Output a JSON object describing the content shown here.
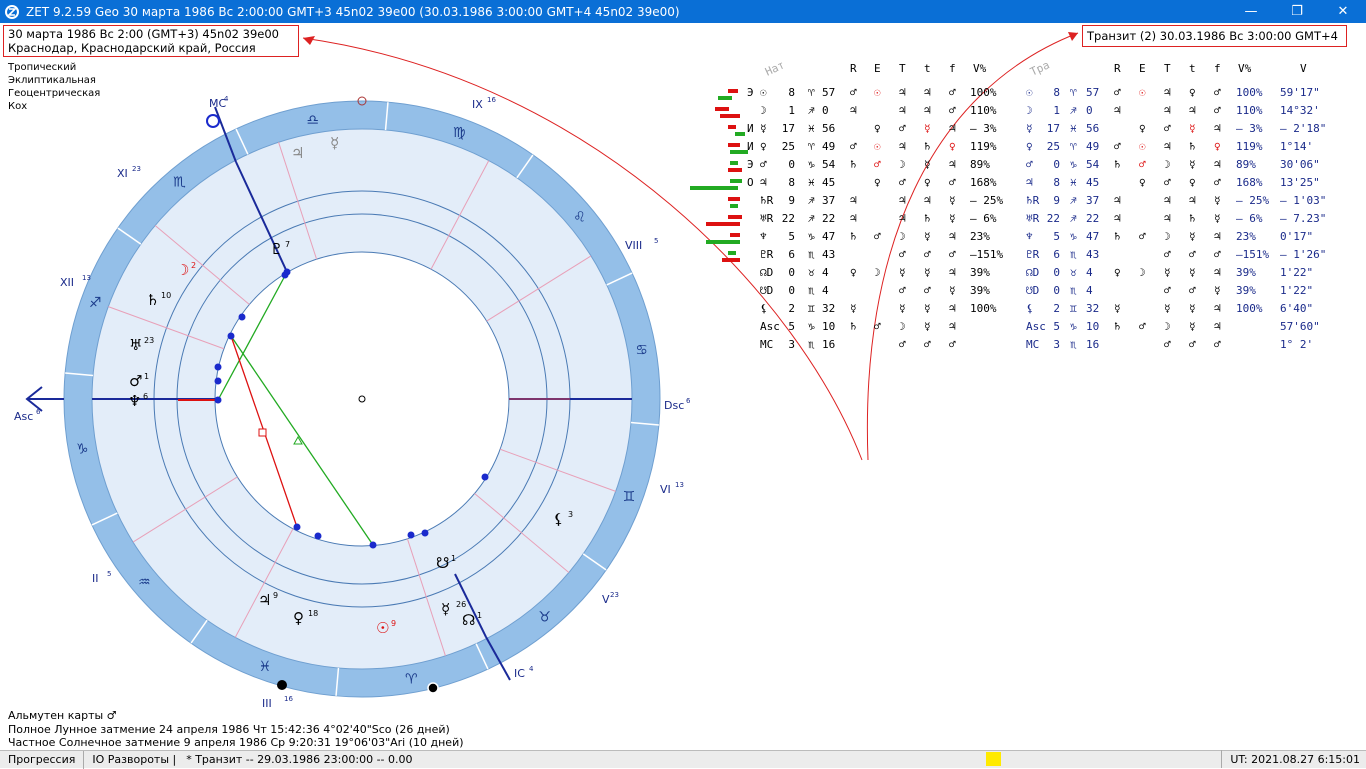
{
  "window": {
    "title": "ZET 9.2.59 Geo   30 марта 1986  Вс   2:00:00 GMT+3 45n02  39e00  (30.03.1986   3:00:00 GMT+4 45n02 39e00)",
    "minimize_icon": "minimize-icon",
    "maximize_icon": "restore-icon",
    "close_icon": "close-icon"
  },
  "info_box": {
    "line1": "30 марта 1986  Вс   2:00 (GMT+3) 45n02  39e00",
    "line2": "Краснодар, Краснодарский край, Россия"
  },
  "transit_box": {
    "text": "Транзит (2) 30.03.1986  Вс  3:00:00 GMT+4"
  },
  "zodiac_info": {
    "line1": "Тропический",
    "line2": "Эклиптикальная",
    "line3": "Геоцентрическая",
    "line4": "Кох"
  },
  "bottom_notes": {
    "line1": "Альмутен карты  ♂",
    "line2": "Полное Лунное затмение 24 апреля 1986 Чт 15:42:36  4°02'40\"Sco (26 дней)",
    "line3": "Частное Солнечное затмение 9 апреля 1986 Ср  9:20:31 19°06'03\"Ari (10 дней)"
  },
  "statusbar": {
    "progression": "Прогрессия",
    "turns": "IO Развороты |",
    "transit": "*  Транзит -- 29.03.1986 23:00:00 -- 0.00",
    "ut": "UT: 2021.08.27  6:15:01"
  },
  "colors": {
    "titlebar": "#0a6fd6",
    "wheel_outer": "#94bfe8",
    "wheel_inner": "#e3edf9",
    "accent_red": "#dd1111",
    "text_blue": "#1a2a8a",
    "aspect_green": "#22aa22"
  },
  "table": {
    "headers": {
      "nat": "Нат",
      "r": "R",
      "e": "E",
      "t": "T",
      "t2": "t",
      "f": "f",
      "v": "V%",
      "tra": "Тра",
      "r2": "R",
      "e2": "E",
      "t3": "T",
      "t4": "t",
      "f2": "f",
      "v2": "V%",
      "vel": "V"
    },
    "rows": [
      {
        "mark": "Э",
        "p": "☉",
        "deg": "8",
        "sign": "♈",
        "min": "57",
        "a": "♂",
        "b": "☉",
        "c": "♃",
        "d": "♃",
        "e": "♂",
        "pct": "100%",
        "tp": "☉",
        "tdeg": "8",
        "tsign": "♈",
        "tmin": "57",
        "ta": "♂",
        "tb": "☉",
        "tc": "♃",
        "td": "♀",
        "te": "♂",
        "tpct": "100%",
        "vel": "59'17\""
      },
      {
        "mark": "",
        "p": "☽",
        "deg": "1",
        "sign": "♐",
        "min": "0",
        "a": "♃",
        "b": "",
        "c": "♃",
        "d": "♃",
        "e": "♂",
        "pct": "110%",
        "tp": "☽",
        "tdeg": "1",
        "tsign": "♐",
        "tmin": "0",
        "ta": "♃",
        "tb": "",
        "tc": "♃",
        "td": "♃",
        "te": "♂",
        "tpct": "110%",
        "vel": "14°32'"
      },
      {
        "mark": "И",
        "p": "☿",
        "deg": "17",
        "sign": "♓",
        "min": "56",
        "a": "",
        "b": "♀",
        "c": "♂",
        "d": "☿",
        "e": "♃",
        "pct": "– 3%",
        "tp": "☿",
        "tdeg": "17",
        "tsign": "♓",
        "tmin": "56",
        "ta": "",
        "tb": "♀",
        "tc": "♂",
        "td": "☿",
        "te": "♃",
        "tpct": "– 3%",
        "vel": "– 2'18\""
      },
      {
        "mark": "И",
        "p": "♀",
        "deg": "25",
        "sign": "♈",
        "min": "49",
        "a": "♂",
        "b": "☉",
        "c": "♃",
        "d": "♄",
        "e": "♀",
        "pct": "119%",
        "tp": "♀",
        "tdeg": "25",
        "tsign": "♈",
        "tmin": "49",
        "ta": "♂",
        "tb": "☉",
        "tc": "♃",
        "td": "♄",
        "te": "♀",
        "tpct": "119%",
        "vel": "1°14'"
      },
      {
        "mark": "Э",
        "p": "♂",
        "deg": "0",
        "sign": "♑",
        "min": "54",
        "a": "♄",
        "b": "♂",
        "c": "☽",
        "d": "☿",
        "e": "♃",
        "pct": "89%",
        "tp": "♂",
        "tdeg": "0",
        "tsign": "♑",
        "tmin": "54",
        "ta": "♄",
        "tb": "♂",
        "tc": "☽",
        "td": "☿",
        "te": "♃",
        "tpct": "89%",
        "vel": "30'06\""
      },
      {
        "mark": "О",
        "p": "♃",
        "deg": "8",
        "sign": "♓",
        "min": "45",
        "a": "",
        "b": "♀",
        "c": "♂",
        "d": "♀",
        "e": "♂",
        "pct": "168%",
        "tp": "♃",
        "tdeg": "8",
        "tsign": "♓",
        "tmin": "45",
        "ta": "",
        "tb": "♀",
        "tc": "♂",
        "td": "♀",
        "te": "♂",
        "tpct": "168%",
        "vel": "13'25\""
      },
      {
        "mark": "",
        "p": "♄R",
        "deg": "9",
        "sign": "♐",
        "min": "37",
        "a": "♃",
        "b": "",
        "c": "♃",
        "d": "♃",
        "e": "☿",
        "pct": "– 25%",
        "tp": "♄R",
        "tdeg": "9",
        "tsign": "♐",
        "tmin": "37",
        "ta": "♃",
        "tb": "",
        "tc": "♃",
        "td": "♃",
        "te": "☿",
        "tpct": "– 25%",
        "vel": "– 1'03\""
      },
      {
        "mark": "",
        "p": "♅R",
        "deg": "22",
        "sign": "♐",
        "min": "22",
        "a": "♃",
        "b": "",
        "c": "♃",
        "d": "♄",
        "e": "☿",
        "pct": "– 6%",
        "tp": "♅R",
        "tdeg": "22",
        "tsign": "♐",
        "tmin": "22",
        "ta": "♃",
        "tb": "",
        "tc": "♃",
        "td": "♄",
        "te": "☿",
        "tpct": "– 6%",
        "vel": "– 7.23\""
      },
      {
        "mark": "",
        "p": "♆",
        "deg": "5",
        "sign": "♑",
        "min": "47",
        "a": "♄",
        "b": "♂",
        "c": "☽",
        "d": "☿",
        "e": "♃",
        "pct": "23%",
        "tp": "♆",
        "tdeg": "5",
        "tsign": "♑",
        "tmin": "47",
        "ta": "♄",
        "tb": "♂",
        "tc": "☽",
        "td": "☿",
        "te": "♃",
        "tpct": "23%",
        "vel": "0'17\""
      },
      {
        "mark": "",
        "p": "♇R",
        "deg": "6",
        "sign": "♏",
        "min": "43",
        "a": "",
        "b": "",
        "c": "♂",
        "d": "♂",
        "e": "♂",
        "pct": "–151%",
        "tp": "♇R",
        "tdeg": "6",
        "tsign": "♏",
        "tmin": "43",
        "ta": "",
        "tb": "",
        "tc": "♂",
        "td": "♂",
        "te": "♂",
        "tpct": "–151%",
        "vel": "– 1'26\""
      },
      {
        "mark": "",
        "p": "☊D",
        "deg": "0",
        "sign": "♉",
        "min": "4",
        "a": "♀",
        "b": "☽",
        "c": "☿",
        "d": "☿",
        "e": "♃",
        "pct": "39%",
        "tp": "☊D",
        "tdeg": "0",
        "tsign": "♉",
        "tmin": "4",
        "ta": "♀",
        "tb": "☽",
        "tc": "☿",
        "td": "☿",
        "te": "♃",
        "tpct": "39%",
        "vel": "1'22\""
      },
      {
        "mark": "",
        "p": "☋D",
        "deg": "0",
        "sign": "♏",
        "min": "4",
        "a": "",
        "b": "",
        "c": "♂",
        "d": "♂",
        "e": "☿",
        "pct": "39%",
        "tp": "☋D",
        "tdeg": "0",
        "tsign": "♏",
        "tmin": "4",
        "ta": "",
        "tb": "",
        "tc": "♂",
        "td": "♂",
        "te": "☿",
        "tpct": "39%",
        "vel": "1'22\""
      },
      {
        "mark": "",
        "p": "⚸",
        "deg": "2",
        "sign": "♊",
        "min": "32",
        "a": "☿",
        "b": "",
        "c": "☿",
        "d": "☿",
        "e": "♃",
        "pct": "100%",
        "tp": "⚸",
        "tdeg": "2",
        "tsign": "♊",
        "tmin": "32",
        "ta": "☿",
        "tb": "",
        "tc": "☿",
        "td": "☿",
        "te": "♃",
        "tpct": "100%",
        "vel": "6'40\""
      },
      {
        "mark": "",
        "p": "Asc",
        "deg": "5",
        "sign": "♑",
        "min": "10",
        "a": "♄",
        "b": "♂",
        "c": "☽",
        "d": "☿",
        "e": "♃",
        "pct": "",
        "tp": "Asc",
        "tdeg": "5",
        "tsign": "♑",
        "tmin": "10",
        "ta": "♄",
        "tb": "♂",
        "tc": "☽",
        "td": "☿",
        "te": "♃",
        "tpct": "",
        "vel": "57'60\""
      },
      {
        "mark": "",
        "p": "MC",
        "deg": "3",
        "sign": "♏",
        "min": "16",
        "a": "",
        "b": "",
        "c": "♂",
        "d": "♂",
        "e": "♂",
        "pct": "",
        "tp": "MC",
        "tdeg": "3",
        "tsign": "♏",
        "tmin": "16",
        "ta": "",
        "tb": "",
        "tc": "♂",
        "td": "♂",
        "te": "♂",
        "tpct": "",
        "vel": "1° 2'"
      }
    ]
  },
  "wheel": {
    "signs": [
      "♑",
      "♒",
      "♓",
      "♈",
      "♉",
      "♊",
      "♋",
      "♌",
      "♍",
      "♎",
      "♏",
      "♐"
    ],
    "house_labels": [
      {
        "text": "XII",
        "sup": "13"
      },
      {
        "text": "XI",
        "sup": "23"
      },
      {
        "text": "IX",
        "sup": "16"
      },
      {
        "text": "VIII",
        "sup": "5"
      },
      {
        "text": "VI",
        "sup": "13"
      },
      {
        "text": "V",
        "sup": "23"
      },
      {
        "text": "III",
        "sup": "16"
      },
      {
        "text": "II",
        "sup": "5"
      },
      {
        "text": "Asc",
        "sup": "6"
      },
      {
        "text": "Dsc",
        "sup": "6"
      },
      {
        "text": "MC",
        "sup": "4"
      },
      {
        "text": "IC",
        "sup": "4"
      }
    ],
    "planets": [
      {
        "glyph": "☽",
        "sup": "2"
      },
      {
        "glyph": "♄",
        "sup": "10"
      },
      {
        "glyph": "♅",
        "sup": "23"
      },
      {
        "glyph": "♂",
        "sup": "1"
      },
      {
        "glyph": "♆",
        "sup": "6"
      },
      {
        "glyph": "♃",
        "sup": "9"
      },
      {
        "glyph": "♀",
        "sup": "18"
      },
      {
        "glyph": "☉",
        "sup": "9"
      },
      {
        "glyph": "☿",
        "sup": "26"
      },
      {
        "glyph": "☊",
        "sup": "1"
      },
      {
        "glyph": "⚸",
        "sup": "3"
      },
      {
        "glyph": "☋",
        "sup": "1"
      },
      {
        "glyph": "♇",
        "sup": "7"
      },
      {
        "glyph": "♃",
        "sup": ""
      },
      {
        "glyph": "☿",
        "sup": ""
      }
    ]
  }
}
